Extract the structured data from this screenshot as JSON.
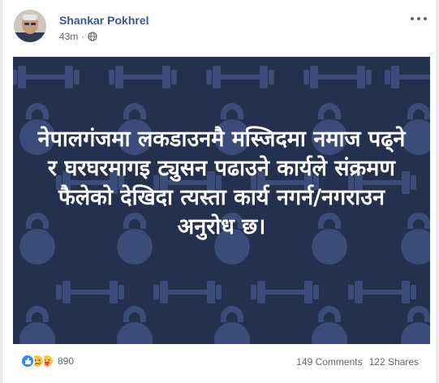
{
  "post": {
    "author": "Shankar Pokhrel",
    "time": "43m",
    "privacy_icon": "globe-icon",
    "image_text": "नेपालगंजमा लकडाउनमै मस्जिदमा नमाज पढ्ने र घरघरमागइ ट्युसन पढाउने कार्यले संक्रमण फैलेको देखिदा त्यस्ता कार्य नगर्न/नगराउन अनुरोध छ।",
    "image_bg_color": "#24314e",
    "image_pattern_icons": [
      "kettlebell-icon",
      "dumbbell-icon"
    ]
  },
  "engagement": {
    "reaction_icons": [
      "like-reaction-icon",
      "sad-reaction-icon",
      "care-reaction-icon"
    ],
    "reactions_count": "890",
    "comments": "149 Comments",
    "shares": "122 Shares"
  }
}
